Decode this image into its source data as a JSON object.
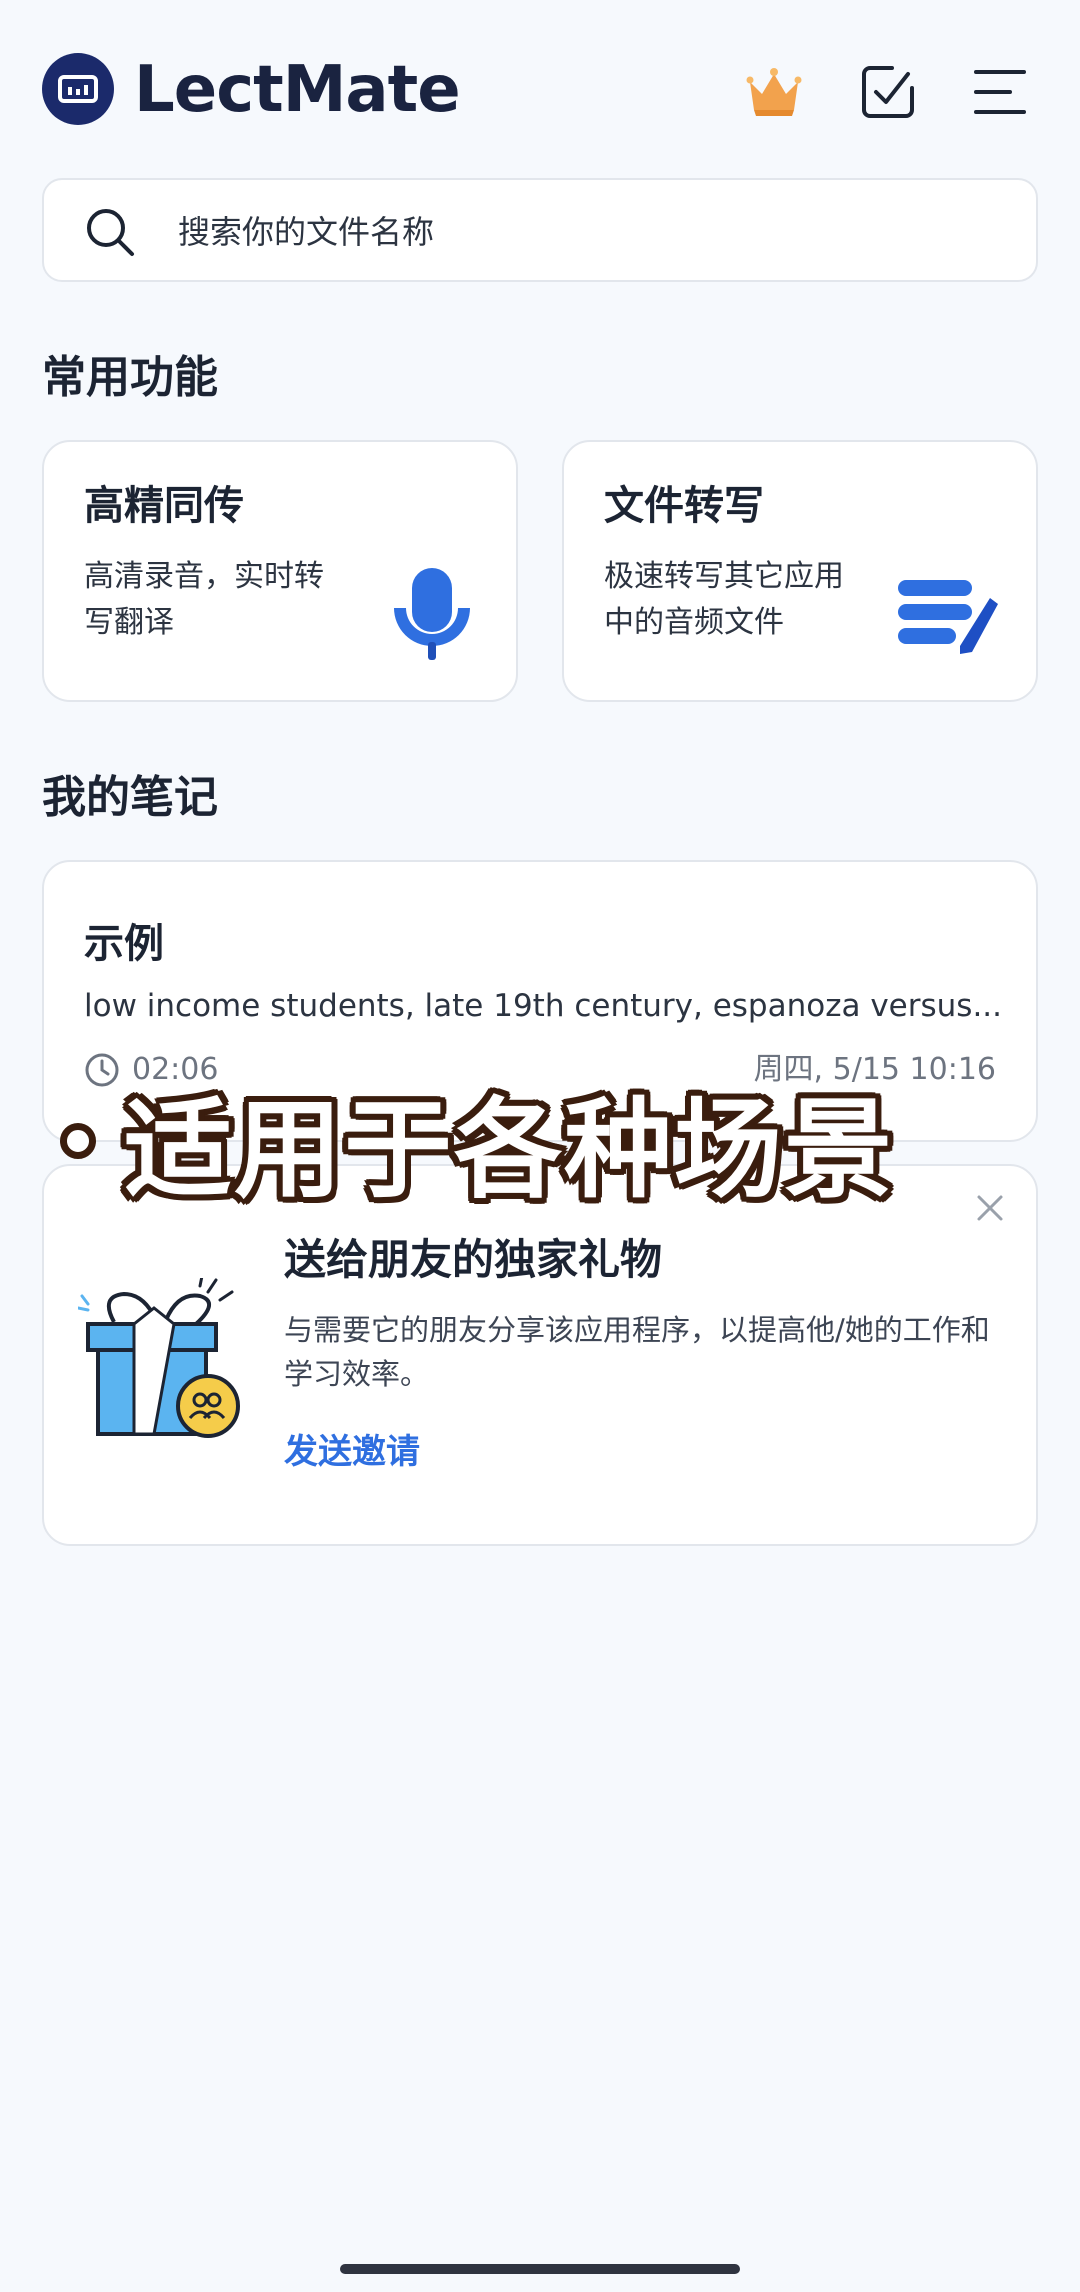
{
  "header": {
    "app_title": "LectMate",
    "icons": [
      "logo-icon",
      "crown-icon",
      "import-icon",
      "menu-icon"
    ]
  },
  "search": {
    "placeholder": "搜索你的文件名称"
  },
  "features": {
    "section_title": "常用功能",
    "items": [
      {
        "title": "高精同传",
        "desc": "高清录音，实时转写翻译",
        "icon": "microphone-icon"
      },
      {
        "title": "文件转写",
        "desc": "极速转写其它应用中的音频文件",
        "icon": "document-edit-icon"
      }
    ]
  },
  "notes": {
    "section_title": "我的笔记",
    "items": [
      {
        "title": "示例",
        "excerpt": "low income students, late 19th century, espanoza versus...",
        "duration": "02:06",
        "date": "周四, 5/15 10:16"
      }
    ]
  },
  "invite": {
    "title": "送给朋友的独家礼物",
    "desc": "与需要它的朋友分享该应用程序，以提高他/她的工作和学习效率。",
    "link": "发送邀请"
  },
  "overlay": {
    "caption": "适用于各种场景"
  },
  "colors": {
    "background": "#f6f9fd",
    "accent_blue": "#2f6fe0",
    "logo_navy": "#1b2a6b",
    "crown_orange": "#f0a04b",
    "caption_outline": "#3a1d0e"
  }
}
